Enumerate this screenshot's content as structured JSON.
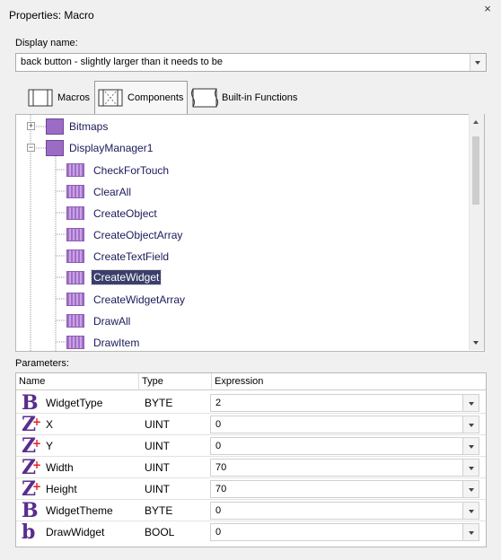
{
  "window": {
    "title": "Properties: Macro",
    "close_glyph": "×"
  },
  "display_name": {
    "label": "Display name:",
    "value": "back button - slightly larger than it needs to be"
  },
  "tabs": [
    {
      "label": "Macros",
      "icon": "macros-icon",
      "selected": false
    },
    {
      "label": "Components",
      "icon": "components-icon",
      "selected": true
    },
    {
      "label": "Built-in Functions",
      "icon": "builtin-functions-icon",
      "selected": false
    }
  ],
  "tree": {
    "folders": [
      {
        "label": "Bitmaps",
        "expander": "+"
      },
      {
        "label": "DisplayManager1",
        "expander": "−"
      }
    ],
    "items": [
      {
        "label": "CheckForTouch"
      },
      {
        "label": "ClearAll"
      },
      {
        "label": "CreateObject"
      },
      {
        "label": "CreateObjectArray"
      },
      {
        "label": "CreateTextField"
      },
      {
        "label": "CreateWidget",
        "selected": true
      },
      {
        "label": "CreateWidgetArray"
      },
      {
        "label": "DrawAll"
      },
      {
        "label": "DrawItem"
      }
    ]
  },
  "parameters": {
    "label": "Parameters:",
    "columns": [
      "Name",
      "Type",
      "Expression"
    ],
    "rows": [
      {
        "icon": "B",
        "icon_name": "byte-type-icon",
        "name": "WidgetType",
        "type": "BYTE",
        "expression": "2"
      },
      {
        "icon": "Z",
        "icon_name": "uint-type-icon",
        "name": "X",
        "type": "UINT",
        "expression": "0"
      },
      {
        "icon": "Z",
        "icon_name": "uint-type-icon",
        "name": "Y",
        "type": "UINT",
        "expression": "0"
      },
      {
        "icon": "Z",
        "icon_name": "uint-type-icon",
        "name": "Width",
        "type": "UINT",
        "expression": "70"
      },
      {
        "icon": "Z",
        "icon_name": "uint-type-icon",
        "name": "Height",
        "type": "UINT",
        "expression": "70"
      },
      {
        "icon": "B",
        "icon_name": "byte-type-icon",
        "name": "WidgetTheme",
        "type": "BYTE",
        "expression": "0"
      },
      {
        "icon": "b",
        "icon_name": "bool-type-icon",
        "name": "DrawWidget",
        "type": "BOOL",
        "expression": "0"
      }
    ]
  }
}
